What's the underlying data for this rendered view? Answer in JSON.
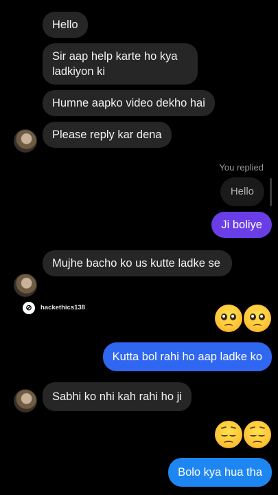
{
  "messages": {
    "m1": "Hello",
    "m2": "Sir aap help karte ho kya ladkiyon ki",
    "m3": "Humne aapko video dekho hai",
    "m4": "Please reply kar dena",
    "replied_label": "You replied",
    "replied_quote": "Hello",
    "o1": "Ji boliye",
    "m5": "Mujhe bacho ko us kutte ladke se",
    "o2": "Kutta bol rahi ho aap ladke ko",
    "m6": "Sabhi ko nhi kah rahi ho ji",
    "o3": "Bolo kya hua tha"
  },
  "watermark": {
    "handle": "hackethics138"
  },
  "reactions": {
    "pleading": [
      "pleading-face",
      "pleading-face"
    ],
    "pensive": [
      "pensive-face",
      "pensive-face"
    ]
  },
  "colors": {
    "incoming_bubble": "#262626",
    "outgoing_purple": "#6a3ee6",
    "outgoing_blue": "#2f67f0",
    "outgoing_lightblue": "#1e86f0",
    "background": "#000000"
  }
}
